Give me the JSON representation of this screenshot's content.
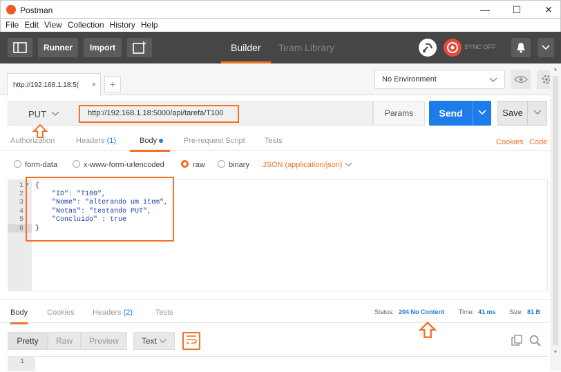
{
  "window": {
    "title": "Postman",
    "minimize": "—",
    "maximize": "☐",
    "close": "✕"
  },
  "menu": [
    "File",
    "Edit",
    "View",
    "Collection",
    "History",
    "Help"
  ],
  "toolbar": {
    "runner": "Runner",
    "import": "Import",
    "tabs": [
      "Builder",
      "Team Library"
    ],
    "active_tab": "Builder",
    "sync": "SYNC OFF",
    "accent": "#f47023"
  },
  "tabs": {
    "open_tab": "http://192.168.1.18:5(",
    "close_glyph": "×",
    "add_glyph": "+",
    "environment": "No Environment"
  },
  "request": {
    "method": "PUT",
    "url": "http://192.168.1.18:5000/api/tarefa/T100",
    "params": "Params",
    "send": "Send",
    "save": "Save",
    "send_color": "#1d7bea"
  },
  "request_tabs": {
    "items": [
      "Authorization",
      "Headers",
      "Body",
      "Pre-request Script",
      "Tests"
    ],
    "headers_count": "(1)",
    "active": "Body",
    "cookies": "Cookies",
    "code": "Code"
  },
  "body_options": {
    "form_data": "form-data",
    "urlencoded": "x-www-form-urlencoded",
    "raw": "raw",
    "binary": "binary",
    "selected": "raw",
    "content_type": "JSON (application/json)"
  },
  "editor": {
    "line_numbers": [
      "1",
      "2",
      "3",
      "4",
      "5",
      "6"
    ],
    "lines": [
      "{",
      "    \"ID\": \"T100\",",
      "    \"Nome\": \"alterando um item\",",
      "    \"Notas\": \"testando PUT\",",
      "    \"Concluido\" : true",
      "}"
    ]
  },
  "response": {
    "tabs": [
      "Body",
      "Cookies",
      "Headers",
      "Tests"
    ],
    "headers_count": "(2)",
    "active": "Body",
    "status_label": "Status:",
    "status_value": "204 No Content",
    "time_label": "Time:",
    "time_value": "41 ms",
    "size_label": "Size:",
    "size_value": "81 B",
    "views": [
      "Pretty",
      "Raw",
      "Preview"
    ],
    "format": "Text",
    "line_numbers": [
      "1"
    ]
  }
}
